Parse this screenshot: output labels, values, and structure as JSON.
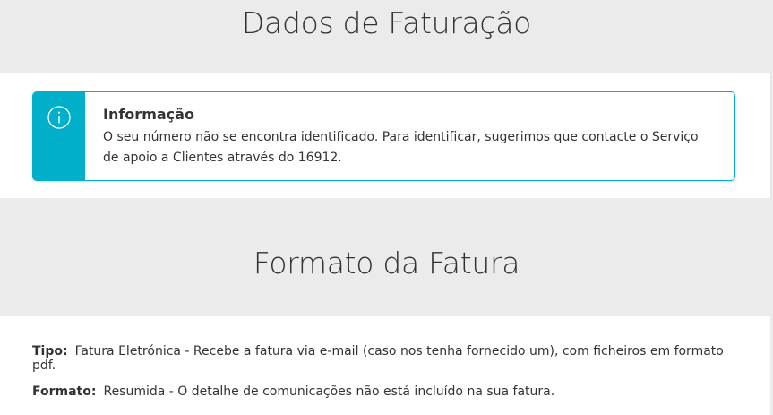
{
  "billing": {
    "title": "Dados de Faturação"
  },
  "info": {
    "icon": "info-icon",
    "accent_color": "#00b0ca",
    "title": "Informação",
    "message": "O seu número não se encontra identificado. Para identificar, sugerimos que contacte o Serviço de apoio a Clientes através do 16912."
  },
  "invoice_format": {
    "title": "Formato da Fatura",
    "type_label": "Tipo:",
    "type_value": "Fatura Eletrónica - Recebe a fatura via e-mail (caso nos tenha fornecido um), com ficheiros em formato pdf.",
    "format_label": "Formato:",
    "format_value": "Resumida - O detalhe de comunicações não está incluído na sua fatura."
  }
}
